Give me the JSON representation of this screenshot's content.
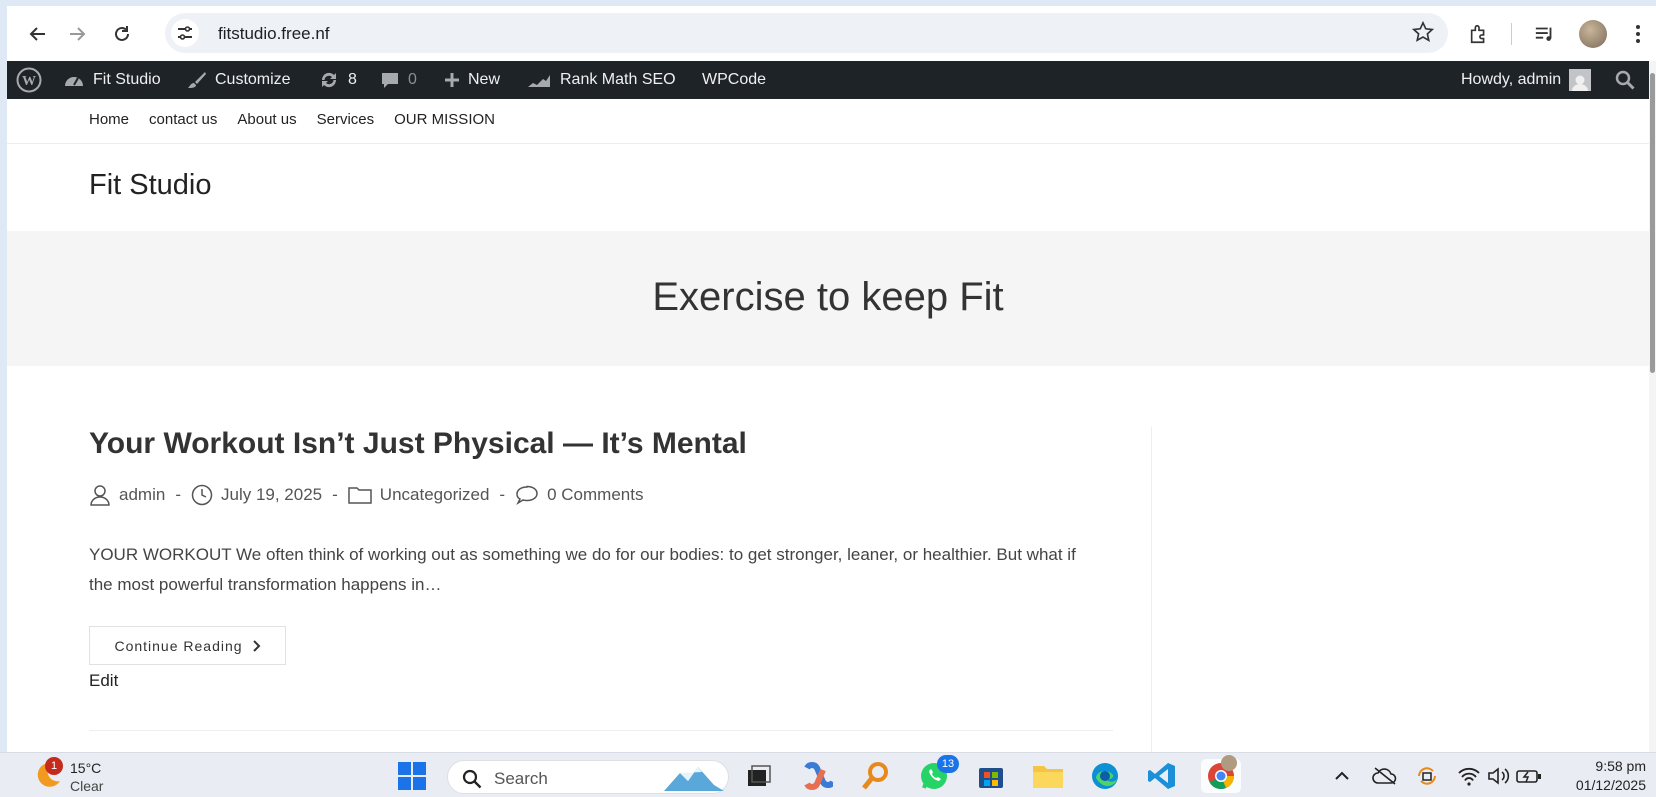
{
  "browser": {
    "url": "fitstudio.free.nf"
  },
  "adminbar": {
    "site_name": "Fit Studio",
    "customize": "Customize",
    "updates_count": "8",
    "comments_count": "0",
    "new_label": "New",
    "rank_math": "Rank Math SEO",
    "wpcode": "WPCode",
    "howdy": "Howdy, admin"
  },
  "site": {
    "nav": [
      "Home",
      "contact us",
      "About us",
      "Services",
      "OUR MISSION"
    ],
    "title": "Fit Studio",
    "hero_title": "Exercise to keep Fit"
  },
  "post": {
    "title": "Your Workout Isn’t Just Physical — It’s Mental",
    "author": "admin",
    "date": "July 19, 2025",
    "category": "Uncategorized",
    "comments": "0 Comments",
    "separator": "-",
    "excerpt": "YOUR WORKOUT We often think of working out as something we do for our bodies: to get stronger, leaner, or healthier. But what if the most powerful transformation happens in…",
    "continue_label": "Continue Reading",
    "edit_label": "Edit"
  },
  "taskbar": {
    "weather_temp": "15°C",
    "weather_desc": "Clear",
    "weather_badge": "1",
    "search_label": "Search",
    "whatsapp_badge": "13",
    "time": "9:58 pm",
    "date": "01/12/2025"
  }
}
